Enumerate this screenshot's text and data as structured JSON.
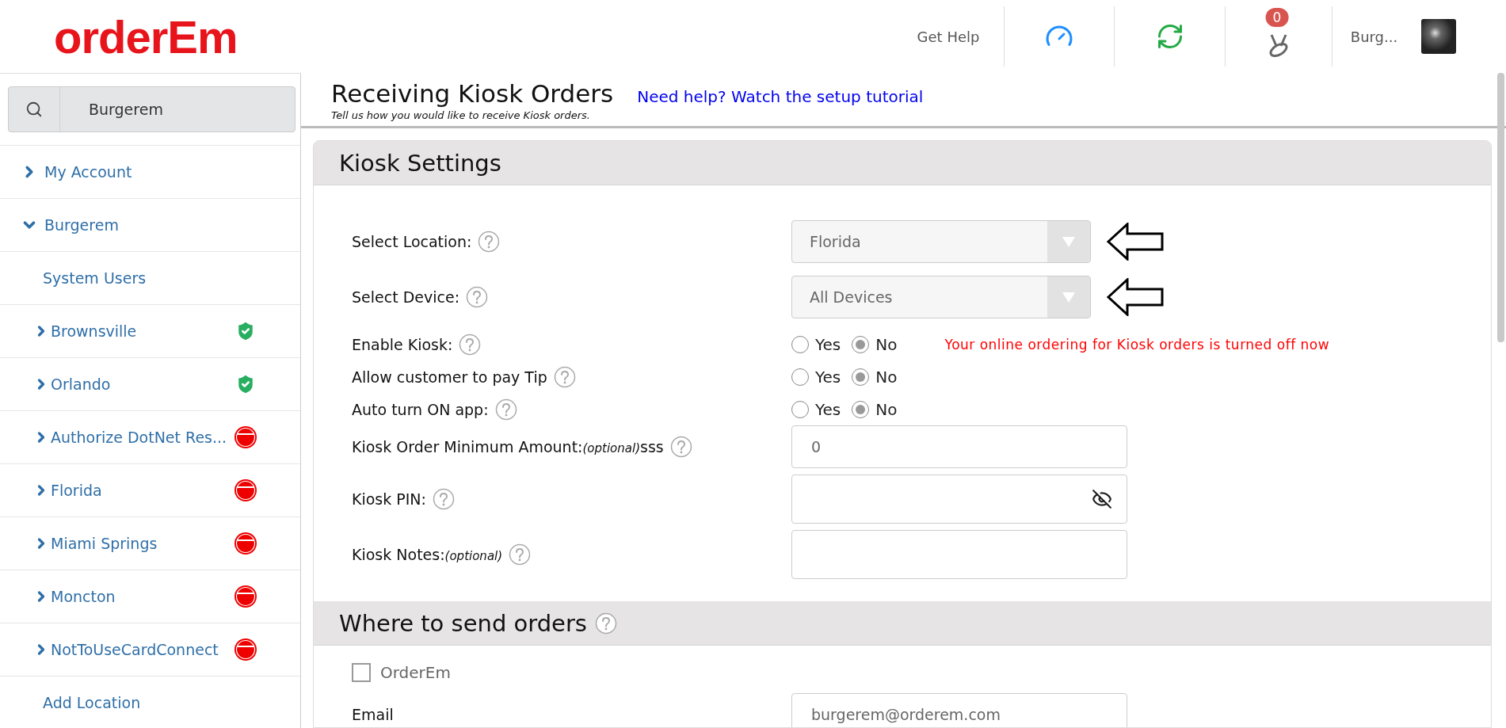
{
  "header": {
    "logo": "orderEm",
    "get_help": "Get Help",
    "notification_count": "0",
    "user_name": "Burg..."
  },
  "sidebar": {
    "search_value": "Burgerem",
    "items": [
      {
        "kind": "group",
        "label": "My Account",
        "expanded": false
      },
      {
        "kind": "group",
        "label": "Burgerem",
        "expanded": true
      },
      {
        "kind": "link",
        "label": "System Users"
      },
      {
        "kind": "location",
        "label": "Brownsville",
        "active": true
      },
      {
        "kind": "location",
        "label": "Orlando",
        "active": true
      },
      {
        "kind": "location",
        "label": "Authorize DotNet Res...",
        "active": false
      },
      {
        "kind": "location",
        "label": "Florida",
        "active": false
      },
      {
        "kind": "location",
        "label": "Miami Springs",
        "active": false
      },
      {
        "kind": "location",
        "label": "Moncton",
        "active": false
      },
      {
        "kind": "location",
        "label": "NotToUseCardConnect",
        "active": false
      },
      {
        "kind": "link",
        "label": "Add Location"
      }
    ]
  },
  "page": {
    "title": "Receiving Kiosk Orders",
    "help_link": "Need help? Watch the setup tutorial",
    "subtitle": "Tell us how you would like to receive Kiosk orders."
  },
  "kiosk_settings": {
    "title": "Kiosk Settings",
    "fields": [
      {
        "kind": "select",
        "label": "Select Location:",
        "value": "Florida",
        "pointed": true
      },
      {
        "kind": "select",
        "label": "Select Device:",
        "value": "All Devices",
        "pointed": true
      },
      {
        "kind": "radio",
        "label": "Enable Kiosk:",
        "options": [
          {
            "label": "Yes",
            "selected": false
          },
          {
            "label": "No",
            "selected": true
          }
        ],
        "message": "Your online ordering for Kiosk orders is turned off now"
      },
      {
        "kind": "radio",
        "label": "Allow customer to pay Tip",
        "options": [
          {
            "label": "Yes",
            "selected": false
          },
          {
            "label": "No",
            "selected": true
          }
        ]
      },
      {
        "kind": "radio",
        "label": "Auto turn ON app:",
        "options": [
          {
            "label": "Yes",
            "selected": false
          },
          {
            "label": "No",
            "selected": true
          }
        ]
      },
      {
        "kind": "input",
        "label": "Kiosk Order Minimum Amount:",
        "optional": "(optional)",
        "suffix": "sss",
        "value": "0"
      },
      {
        "kind": "password",
        "label": "Kiosk PIN:"
      },
      {
        "kind": "notes",
        "label": "Kiosk Notes:",
        "optional": "(optional)"
      }
    ]
  },
  "send_orders": {
    "title": "Where to send orders",
    "checkbox": {
      "label": "OrderEm",
      "checked": false
    },
    "email_label": "Email",
    "email_value": "burgerem@orderem.com"
  }
}
